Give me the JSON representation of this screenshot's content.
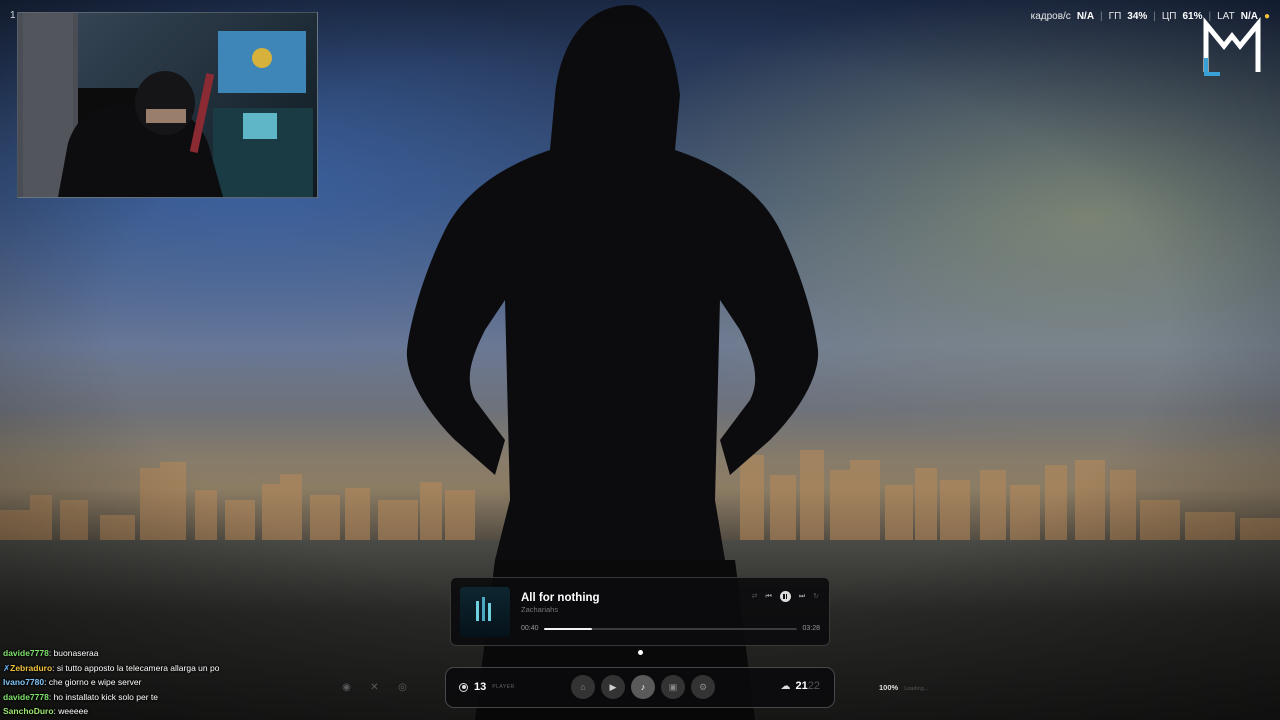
{
  "webcam": {
    "corner_label": "1"
  },
  "hud": {
    "fps_label": "кадров/с",
    "fps_value": "N/A",
    "gpu_label": "ГП",
    "gpu_value": "34%",
    "cpu_label": "ЦП",
    "cpu_value": "61%",
    "lat_label": "LAT",
    "lat_value": "N/A"
  },
  "chat": [
    {
      "user": "davide7778",
      "message": "buonaseraa"
    },
    {
      "user": "Zebraduro",
      "message": "si tutto apposto la telecamera allarga un po"
    },
    {
      "user": "Ivano7780",
      "message": "che giorno e wipe server"
    },
    {
      "user": "davide7778",
      "message": "ho installato kick solo per te"
    },
    {
      "user": "SanchoDuro",
      "message": "weeeee"
    }
  ],
  "player": {
    "title": "All for nothing",
    "artist": "Zachariahs",
    "current_time": "00:40",
    "total_time": "03:28",
    "progress": 0.19
  },
  "dock": {
    "players_count": "13",
    "players_label": "PLAYER",
    "temp_value": "21",
    "temp_secondary": "22",
    "load_percent": "100%",
    "load_label": "Loading..."
  },
  "colors": {
    "accent_user_1": "#7ee16a",
    "accent_user_2": "#f0c23c",
    "accent_user_3": "#7fc3f5",
    "logo_blue": "#3aa0d8"
  }
}
